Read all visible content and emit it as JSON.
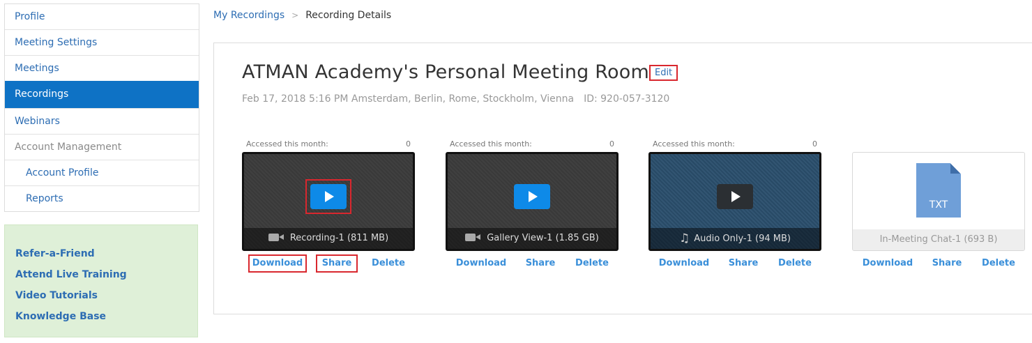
{
  "sidebar": {
    "items": [
      {
        "label": "Profile"
      },
      {
        "label": "Meeting Settings"
      },
      {
        "label": "Meetings"
      },
      {
        "label": "Recordings"
      },
      {
        "label": "Webinars"
      },
      {
        "label": "Account Management"
      },
      {
        "label": "Account Profile"
      },
      {
        "label": "Reports"
      }
    ],
    "promo_links": [
      "Refer-a-Friend",
      "Attend Live Training",
      "Video Tutorials",
      "Knowledge Base"
    ]
  },
  "breadcrumb": {
    "parent": "My Recordings",
    "separator": ">",
    "current": "Recording Details"
  },
  "meeting": {
    "title": "ATMAN Academy's Personal Meeting Room",
    "edit_label": "Edit",
    "datetime": "Feb 17, 2018 5:16 PM Amsterdam, Berlin, Rome, Stockholm, Vienna",
    "meeting_id": "ID: 920-057-3120"
  },
  "recordings": [
    {
      "accessed_label": "Accessed this month:",
      "accessed_count": "0",
      "name": "Recording-1 (811 MB)",
      "icon": "video-camera-icon"
    },
    {
      "accessed_label": "Accessed this month:",
      "accessed_count": "0",
      "name": "Gallery View-1 (1.85 GB)",
      "icon": "video-camera-icon"
    },
    {
      "accessed_label": "Accessed this month:",
      "accessed_count": "0",
      "name": "Audio Only-1 (94 MB)",
      "icon": "music-note-icon"
    },
    {
      "name": "In-Meeting Chat-1 (693 B)",
      "file_ext": "TXT",
      "icon": "text-file-icon"
    }
  ],
  "actions": {
    "download": "Download",
    "share": "Share",
    "delete": "Delete"
  },
  "colors": {
    "accent_blue": "#0e72c5",
    "link_blue": "#2d6db3",
    "highlight_red": "#d9272e",
    "promo_green": "#dff0d8"
  }
}
